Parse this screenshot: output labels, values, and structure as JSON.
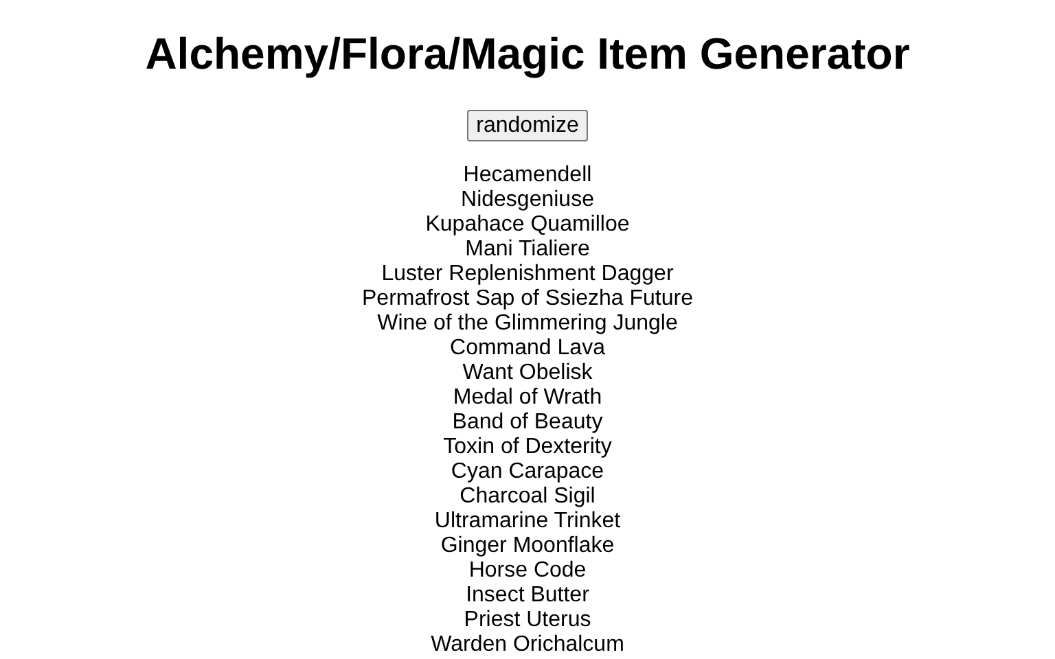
{
  "title": "Alchemy/Flora/Magic Item Generator",
  "button": "randomize",
  "items": [
    "Hecamendell",
    "Nidesgeniuse",
    "Kupahace Quamilloe",
    "Mani Tialiere",
    "Luster Replenishment Dagger",
    "Permafrost Sap of Ssiezha Future",
    "Wine of the Glimmering Jungle",
    "Command Lava",
    "Want Obelisk",
    "Medal of Wrath",
    "Band of Beauty",
    "Toxin of Dexterity",
    "Cyan Carapace",
    "Charcoal Sigil",
    "Ultramarine Trinket",
    "Ginger Moonflake",
    "Horse Code",
    "Insect Butter",
    "Priest Uterus",
    "Warden Orichalcum"
  ]
}
